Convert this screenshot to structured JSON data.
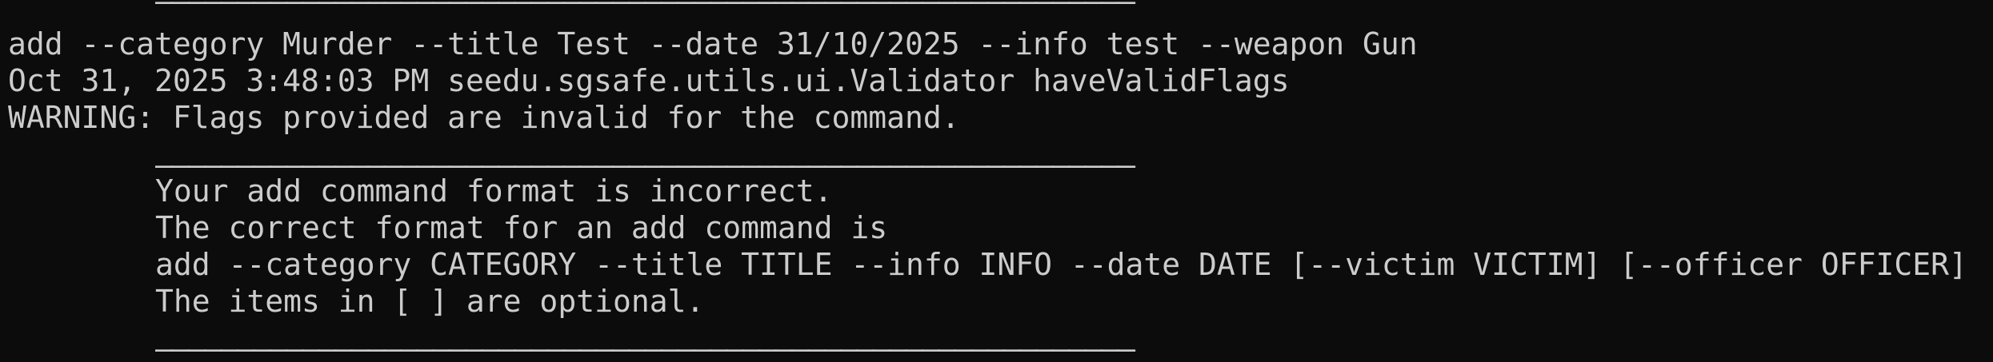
{
  "terminal": {
    "divider": "————————————————————————————————————————————————————————————",
    "command_input": "add --category Murder --title Test --date 31/10/2025 --info test --weapon Gun",
    "log_line": "Oct 31, 2025 3:48:03 PM seedu.sgsafe.utils.ui.Validator haveValidFlags",
    "warning_line": "WARNING: Flags provided are invalid for the command.",
    "error_message": "Your add command format is incorrect.",
    "correct_format_intro": "The correct format for an add command is",
    "correct_format_usage": "add --category CATEGORY --title TITLE --info INFO --date DATE [--victim VICTIM] [--officer OFFICER]",
    "optional_note": "The items in [ ] are optional."
  },
  "colors": {
    "background": "#0c0c0c",
    "foreground": "#cccccc"
  }
}
